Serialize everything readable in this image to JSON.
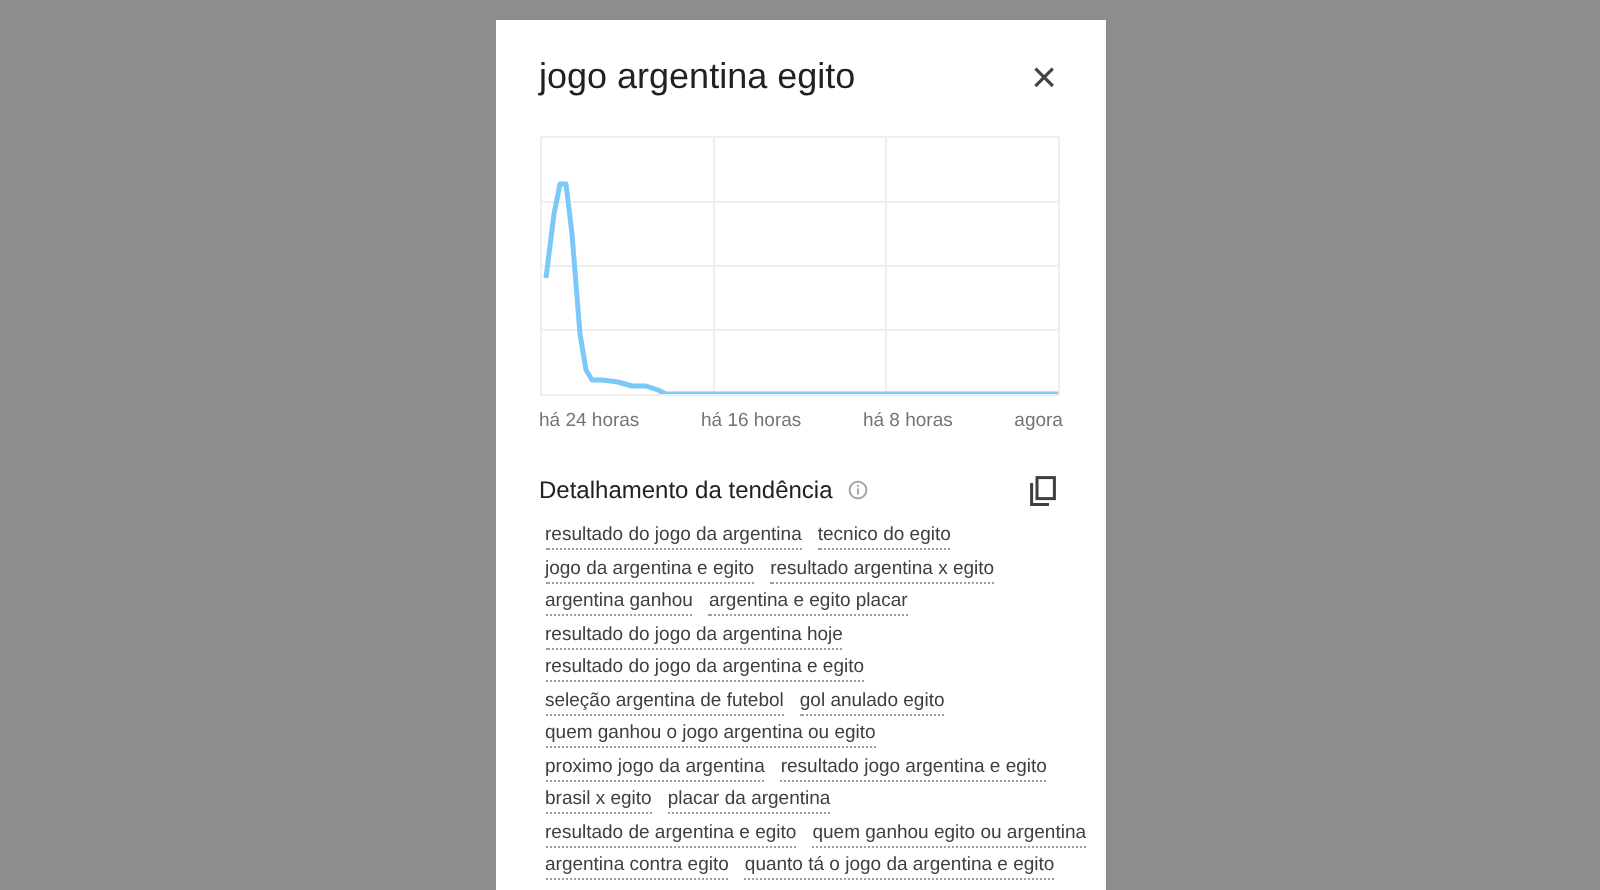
{
  "dialog": {
    "title": "jogo argentina egito",
    "close": "×"
  },
  "chart": {
    "x_labels": [
      "há 24 horas",
      "há 16 horas",
      "há 8 horas",
      "agora"
    ]
  },
  "breakdown": {
    "title": "Detalhamento da tendência",
    "term_rows": [
      [
        "resultado do jogo da argentina",
        "tecnico do egito"
      ],
      [
        "jogo da argentina e egito",
        "resultado argentina x egito"
      ],
      [
        "argentina ganhou",
        "argentina e egito placar"
      ],
      [
        "resultado do jogo da argentina hoje"
      ],
      [
        "resultado do jogo da argentina e egito"
      ],
      [
        "seleção argentina de futebol",
        "gol anulado egito"
      ],
      [
        "quem ganhou o jogo argentina ou egito"
      ],
      [
        "proximo jogo da argentina",
        "resultado jogo argentina e egito"
      ],
      [
        "brasil x egito",
        "placar da argentina"
      ],
      [
        "resultado de argentina e egito",
        "quem ganhou egito ou argentina"
      ],
      [
        "argentina contra egito",
        "quanto tá o jogo da argentina e egito"
      ]
    ]
  }
}
